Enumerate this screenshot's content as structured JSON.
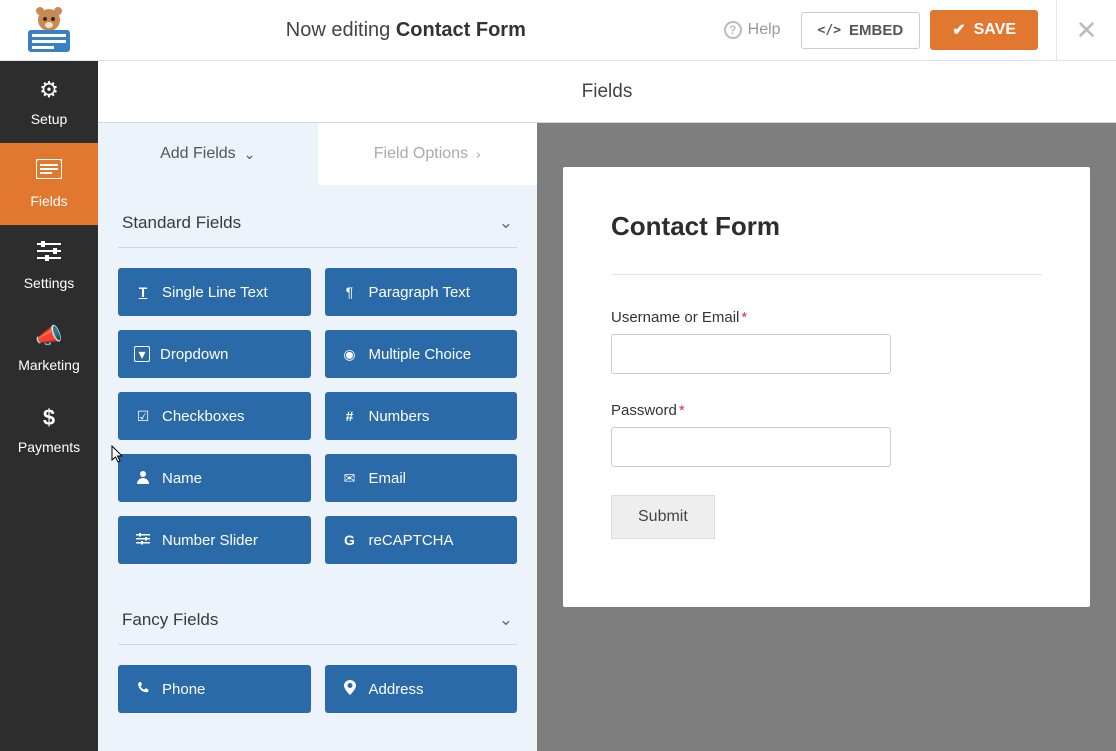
{
  "header": {
    "editing_prefix": "Now editing",
    "form_name": "Contact Form",
    "help_label": "Help",
    "embed_label": "EMBED",
    "save_label": "SAVE"
  },
  "sidebar": {
    "items": [
      {
        "icon": "gear-icon",
        "label": "Setup"
      },
      {
        "icon": "list-icon",
        "label": "Fields"
      },
      {
        "icon": "sliders-icon",
        "label": "Settings"
      },
      {
        "icon": "bullhorn-icon",
        "label": "Marketing"
      },
      {
        "icon": "dollar-icon",
        "label": "Payments"
      }
    ],
    "active_index": 1
  },
  "panel": {
    "title": "Fields",
    "tabs": [
      {
        "label": "Add Fields",
        "active": true
      },
      {
        "label": "Field Options",
        "active": false
      }
    ],
    "groups": [
      {
        "title": "Standard Fields",
        "fields": [
          {
            "icon": "text-icon",
            "glyph": "T",
            "label": "Single Line Text"
          },
          {
            "icon": "paragraph-icon",
            "glyph": "¶",
            "label": "Paragraph Text"
          },
          {
            "icon": "caret-square-icon",
            "glyph": "▾",
            "label": "Dropdown"
          },
          {
            "icon": "dot-circle-icon",
            "glyph": "◉",
            "label": "Multiple Choice"
          },
          {
            "icon": "check-square-icon",
            "glyph": "☑",
            "label": "Checkboxes"
          },
          {
            "icon": "hash-icon",
            "glyph": "#",
            "label": "Numbers"
          },
          {
            "icon": "user-icon",
            "glyph": "👤",
            "label": "Name"
          },
          {
            "icon": "envelope-icon",
            "glyph": "✉",
            "label": "Email"
          },
          {
            "icon": "sliders-h-icon",
            "glyph": "≡",
            "label": "Number Slider"
          },
          {
            "icon": "google-icon",
            "glyph": "G",
            "label": "reCAPTCHA"
          }
        ]
      },
      {
        "title": "Fancy Fields",
        "fields": [
          {
            "icon": "phone-icon",
            "glyph": "✆",
            "label": "Phone"
          },
          {
            "icon": "map-marker-icon",
            "glyph": "📍",
            "label": "Address"
          }
        ]
      }
    ]
  },
  "preview": {
    "form_title": "Contact Form",
    "fields": [
      {
        "label": "Username or Email",
        "required": true,
        "type": "text"
      },
      {
        "label": "Password",
        "required": true,
        "type": "password"
      }
    ],
    "submit_label": "Submit"
  }
}
